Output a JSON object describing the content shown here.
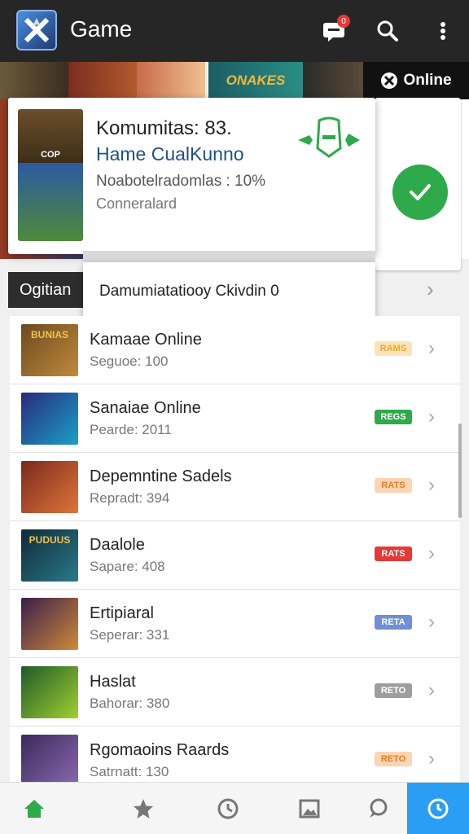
{
  "app": {
    "title": "Game",
    "notification_count": "0"
  },
  "banner": {
    "brand_text": "ONAKES",
    "online_text": "Online"
  },
  "popup": {
    "title": "Komumitas: 83.",
    "subtitle": "Hame CualKunno",
    "note": "Noabotelradomlas : 10%",
    "meta": "Conneralard",
    "art_caption": "COP"
  },
  "section": {
    "label": "Ogitian"
  },
  "dropdown": {
    "item": "Damumiatatiooy Ckivdin 0"
  },
  "games": [
    {
      "name": "Kamaae Online",
      "meta": "Seguoe: 100",
      "tag": "RAMS",
      "tag_color": "#f6a623",
      "tag_bg": "#fde4b8",
      "thumb_text": "BUNIAS",
      "thumb_from": "#6b4a1e",
      "thumb_to": "#c08a3e"
    },
    {
      "name": "Sanaiae Online",
      "meta": "Pearde: 2011",
      "tag": "REGS",
      "tag_color": "#ffffff",
      "tag_bg": "#2eaa4a",
      "thumb_text": "",
      "thumb_from": "#2a2a7a",
      "thumb_to": "#1aa0c8"
    },
    {
      "name": "Depemntine Sadels",
      "meta": "Repradt: 394",
      "tag": "RATS",
      "tag_color": "#e67e22",
      "tag_bg": "#fbd5b4",
      "thumb_text": "",
      "thumb_from": "#7a2a1e",
      "thumb_to": "#e0743a"
    },
    {
      "name": "Daalole",
      "meta": "Sapare: 408",
      "tag": "RATS",
      "tag_color": "#ffffff",
      "tag_bg": "#e53935",
      "thumb_text": "PUDUUS",
      "thumb_from": "#0e2a3a",
      "thumb_to": "#2a7a8a"
    },
    {
      "name": "Ertipiaral",
      "meta": "Seperar: 331",
      "tag": "RETA",
      "tag_color": "#ffffff",
      "tag_bg": "#6f8fd6",
      "thumb_text": "",
      "thumb_from": "#3a1e4a",
      "thumb_to": "#d08a3a"
    },
    {
      "name": "Haslat",
      "meta": "Bahorar: 380",
      "tag": "RETO",
      "tag_color": "#ffffff",
      "tag_bg": "#9e9e9e",
      "thumb_text": "",
      "thumb_from": "#1e5a2a",
      "thumb_to": "#a0d030"
    },
    {
      "name": "Rgomaoins Raards",
      "meta": "Satrnatt: 130",
      "tag": "RETO",
      "tag_color": "#e67e22",
      "tag_bg": "#fbd5b4",
      "thumb_text": "",
      "thumb_from": "#3a2a5a",
      "thumb_to": "#8a6ab0"
    }
  ],
  "icons": {
    "logo": "game-logo",
    "notify": "chat-bubble-icon",
    "search": "search-icon",
    "more": "more-vert-icon",
    "nav": [
      "home-icon",
      "star-icon",
      "history-icon",
      "image-icon",
      "chat-icon",
      "clock-icon"
    ]
  },
  "colors": {
    "accent": "#2a9df4",
    "success": "#2eaa4a",
    "home": "#2eaa4a"
  }
}
